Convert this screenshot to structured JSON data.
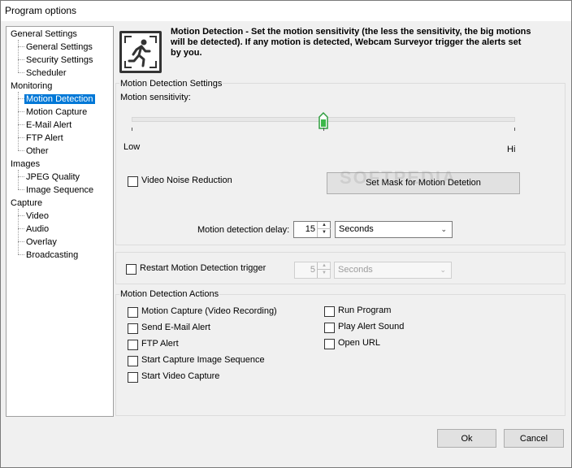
{
  "window": {
    "title": "Program options"
  },
  "tree": {
    "general": {
      "label": "General Settings",
      "children": [
        "General Settings",
        "Security Settings",
        "Scheduler"
      ]
    },
    "monitoring": {
      "label": "Monitoring",
      "children": [
        "Motion Detection",
        "Motion Capture",
        "E-Mail Alert",
        "FTP Alert",
        "Other"
      ]
    },
    "images": {
      "label": "Images",
      "children": [
        "JPEG Quality",
        "Image Sequence"
      ]
    },
    "capture": {
      "label": "Capture",
      "children": [
        "Video",
        "Audio",
        "Overlay",
        "Broadcasting"
      ]
    },
    "selected": "Motion Detection"
  },
  "header": {
    "icon": "running-man-icon",
    "line1": "Motion Detection - Set the motion sensitivity (the less the sensitivity, the big motions",
    "line2": "will be detected). If any motion is detected, Webcam Surveyor trigger the alerts set",
    "line3": "by you."
  },
  "settings": {
    "group_title": "Motion Detection Settings",
    "sensitivity_label": "Motion sensitivity:",
    "low_label": "Low",
    "hi_label": "Hi",
    "sensitivity_value": 0.5,
    "noise_reduction_label": "Video Noise Reduction",
    "noise_reduction_checked": false,
    "mask_button": "Set Mask for Motion Detetion",
    "delay_label": "Motion detection delay:",
    "delay_value": "15",
    "delay_unit": "Seconds"
  },
  "restart": {
    "label": "Restart Motion Detection trigger",
    "checked": false,
    "value": "5",
    "unit": "Seconds"
  },
  "actions": {
    "group_title": "Motion Detection Actions",
    "left": [
      "Motion Capture (Video Recording)",
      "Send E-Mail  Alert",
      "FTP Alert",
      "Start Capture Image Sequence",
      "Start Video Capture"
    ],
    "right": [
      "Run Program",
      "Play Alert Sound",
      "Open URL"
    ]
  },
  "watermark": "SOFTPEDIA",
  "buttons": {
    "ok": "Ok",
    "cancel": "Cancel"
  }
}
